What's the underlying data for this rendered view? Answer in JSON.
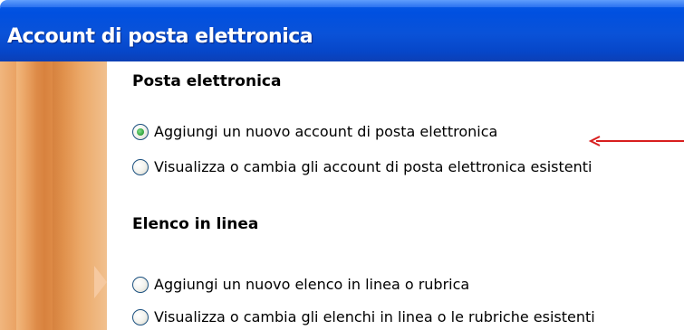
{
  "window": {
    "title": "Account di posta elettronica"
  },
  "sections": [
    {
      "title": "Posta elettronica",
      "options": [
        {
          "label": "Aggiungi un nuovo account di posta elettronica",
          "checked": true
        },
        {
          "label": "Visualizza o cambia gli account di posta elettronica esistenti",
          "checked": false
        }
      ]
    },
    {
      "title": "Elenco in linea",
      "options": [
        {
          "label": "Aggiungi un nuovo elenco in linea o rubrica",
          "checked": false
        },
        {
          "label": "Visualizza o cambia gli elenchi in linea o le rubriche esistenti",
          "checked": false
        }
      ]
    }
  ],
  "colors": {
    "titlebar": "#0a52d8",
    "side_panel": "#e79a58",
    "annotation_arrow": "#d81e1e",
    "radio_selected": "#2f9f3a"
  }
}
